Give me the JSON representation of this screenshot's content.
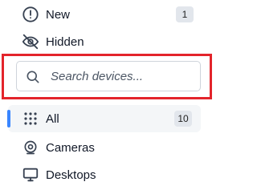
{
  "sidebar": {
    "items": [
      {
        "label": "New",
        "icon": "alert-circle-icon",
        "badge": "1"
      },
      {
        "label": "Hidden",
        "icon": "eye-off-icon",
        "badge": ""
      }
    ]
  },
  "search": {
    "placeholder": "Search devices..."
  },
  "categories": [
    {
      "label": "All",
      "icon": "grid-dots-icon",
      "badge": "10",
      "active": true
    },
    {
      "label": "Cameras",
      "icon": "camera-icon",
      "badge": ""
    },
    {
      "label": "Desktops",
      "icon": "monitor-icon",
      "badge": ""
    }
  ],
  "colors": {
    "accent": "#3a86ff",
    "highlight": "#e3242b",
    "badge_bg": "#e2e6ec"
  }
}
